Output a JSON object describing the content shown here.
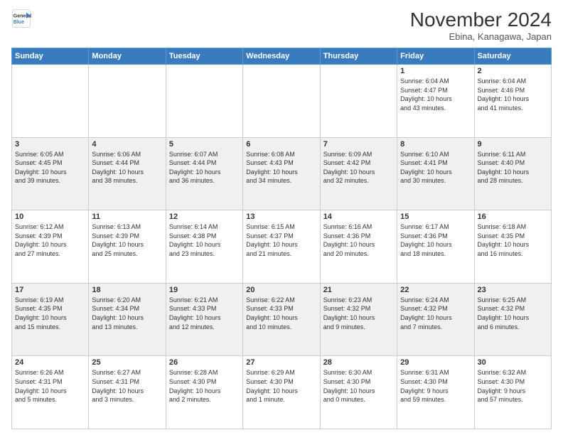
{
  "header": {
    "logo_line1": "General",
    "logo_line2": "Blue",
    "month": "November 2024",
    "location": "Ebina, Kanagawa, Japan"
  },
  "days_of_week": [
    "Sunday",
    "Monday",
    "Tuesday",
    "Wednesday",
    "Thursday",
    "Friday",
    "Saturday"
  ],
  "weeks": [
    [
      {
        "day": "",
        "info": ""
      },
      {
        "day": "",
        "info": ""
      },
      {
        "day": "",
        "info": ""
      },
      {
        "day": "",
        "info": ""
      },
      {
        "day": "",
        "info": ""
      },
      {
        "day": "1",
        "info": "Sunrise: 6:04 AM\nSunset: 4:47 PM\nDaylight: 10 hours\nand 43 minutes."
      },
      {
        "day": "2",
        "info": "Sunrise: 6:04 AM\nSunset: 4:46 PM\nDaylight: 10 hours\nand 41 minutes."
      }
    ],
    [
      {
        "day": "3",
        "info": "Sunrise: 6:05 AM\nSunset: 4:45 PM\nDaylight: 10 hours\nand 39 minutes."
      },
      {
        "day": "4",
        "info": "Sunrise: 6:06 AM\nSunset: 4:44 PM\nDaylight: 10 hours\nand 38 minutes."
      },
      {
        "day": "5",
        "info": "Sunrise: 6:07 AM\nSunset: 4:44 PM\nDaylight: 10 hours\nand 36 minutes."
      },
      {
        "day": "6",
        "info": "Sunrise: 6:08 AM\nSunset: 4:43 PM\nDaylight: 10 hours\nand 34 minutes."
      },
      {
        "day": "7",
        "info": "Sunrise: 6:09 AM\nSunset: 4:42 PM\nDaylight: 10 hours\nand 32 minutes."
      },
      {
        "day": "8",
        "info": "Sunrise: 6:10 AM\nSunset: 4:41 PM\nDaylight: 10 hours\nand 30 minutes."
      },
      {
        "day": "9",
        "info": "Sunrise: 6:11 AM\nSunset: 4:40 PM\nDaylight: 10 hours\nand 28 minutes."
      }
    ],
    [
      {
        "day": "10",
        "info": "Sunrise: 6:12 AM\nSunset: 4:39 PM\nDaylight: 10 hours\nand 27 minutes."
      },
      {
        "day": "11",
        "info": "Sunrise: 6:13 AM\nSunset: 4:39 PM\nDaylight: 10 hours\nand 25 minutes."
      },
      {
        "day": "12",
        "info": "Sunrise: 6:14 AM\nSunset: 4:38 PM\nDaylight: 10 hours\nand 23 minutes."
      },
      {
        "day": "13",
        "info": "Sunrise: 6:15 AM\nSunset: 4:37 PM\nDaylight: 10 hours\nand 21 minutes."
      },
      {
        "day": "14",
        "info": "Sunrise: 6:16 AM\nSunset: 4:36 PM\nDaylight: 10 hours\nand 20 minutes."
      },
      {
        "day": "15",
        "info": "Sunrise: 6:17 AM\nSunset: 4:36 PM\nDaylight: 10 hours\nand 18 minutes."
      },
      {
        "day": "16",
        "info": "Sunrise: 6:18 AM\nSunset: 4:35 PM\nDaylight: 10 hours\nand 16 minutes."
      }
    ],
    [
      {
        "day": "17",
        "info": "Sunrise: 6:19 AM\nSunset: 4:35 PM\nDaylight: 10 hours\nand 15 minutes."
      },
      {
        "day": "18",
        "info": "Sunrise: 6:20 AM\nSunset: 4:34 PM\nDaylight: 10 hours\nand 13 minutes."
      },
      {
        "day": "19",
        "info": "Sunrise: 6:21 AM\nSunset: 4:33 PM\nDaylight: 10 hours\nand 12 minutes."
      },
      {
        "day": "20",
        "info": "Sunrise: 6:22 AM\nSunset: 4:33 PM\nDaylight: 10 hours\nand 10 minutes."
      },
      {
        "day": "21",
        "info": "Sunrise: 6:23 AM\nSunset: 4:32 PM\nDaylight: 10 hours\nand 9 minutes."
      },
      {
        "day": "22",
        "info": "Sunrise: 6:24 AM\nSunset: 4:32 PM\nDaylight: 10 hours\nand 7 minutes."
      },
      {
        "day": "23",
        "info": "Sunrise: 6:25 AM\nSunset: 4:32 PM\nDaylight: 10 hours\nand 6 minutes."
      }
    ],
    [
      {
        "day": "24",
        "info": "Sunrise: 6:26 AM\nSunset: 4:31 PM\nDaylight: 10 hours\nand 5 minutes."
      },
      {
        "day": "25",
        "info": "Sunrise: 6:27 AM\nSunset: 4:31 PM\nDaylight: 10 hours\nand 3 minutes."
      },
      {
        "day": "26",
        "info": "Sunrise: 6:28 AM\nSunset: 4:30 PM\nDaylight: 10 hours\nand 2 minutes."
      },
      {
        "day": "27",
        "info": "Sunrise: 6:29 AM\nSunset: 4:30 PM\nDaylight: 10 hours\nand 1 minute."
      },
      {
        "day": "28",
        "info": "Sunrise: 6:30 AM\nSunset: 4:30 PM\nDaylight: 10 hours\nand 0 minutes."
      },
      {
        "day": "29",
        "info": "Sunrise: 6:31 AM\nSunset: 4:30 PM\nDaylight: 9 hours\nand 59 minutes."
      },
      {
        "day": "30",
        "info": "Sunrise: 6:32 AM\nSunset: 4:30 PM\nDaylight: 9 hours\nand 57 minutes."
      }
    ]
  ]
}
